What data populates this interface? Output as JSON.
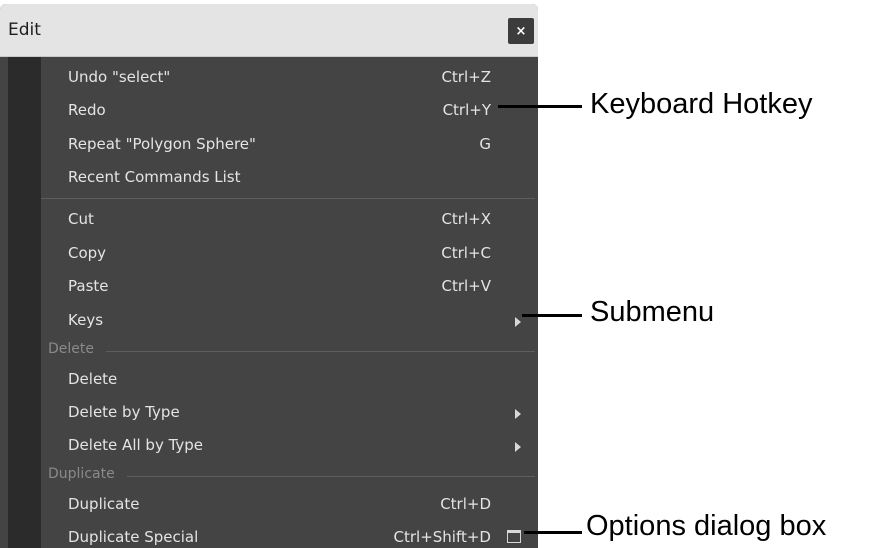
{
  "window": {
    "title": "Edit",
    "close_label": "×"
  },
  "menu": {
    "items": [
      {
        "label": "Undo \"select\"",
        "hotkey": "Ctrl+Z"
      },
      {
        "label": "Redo",
        "hotkey": "Ctrl+Y"
      },
      {
        "label": "Repeat \"Polygon Sphere\"",
        "hotkey": "G"
      },
      {
        "label": "Recent Commands List",
        "hotkey": ""
      },
      {
        "label": "Cut",
        "hotkey": "Ctrl+X"
      },
      {
        "label": "Copy",
        "hotkey": "Ctrl+C"
      },
      {
        "label": "Paste",
        "hotkey": "Ctrl+V"
      },
      {
        "label": "Keys",
        "hotkey": ""
      },
      {
        "label": "Delete",
        "hotkey": ""
      },
      {
        "label": "Delete by Type",
        "hotkey": ""
      },
      {
        "label": "Delete All by Type",
        "hotkey": ""
      },
      {
        "label": "Duplicate",
        "hotkey": "Ctrl+D"
      },
      {
        "label": "Duplicate Special",
        "hotkey": "Ctrl+Shift+D"
      }
    ],
    "sections": {
      "delete": "Delete",
      "duplicate": "Duplicate"
    }
  },
  "annotations": {
    "hotkey": "Keyboard Hotkey",
    "submenu": "Submenu",
    "options": "Options dialog box"
  },
  "colors": {
    "menu_bg": "#444444",
    "menu_text": "#e4e4e4",
    "section_text": "#8a8a8a",
    "titlebar_bg": "#e4e4e4",
    "left_strip": "#2b2b2b"
  }
}
